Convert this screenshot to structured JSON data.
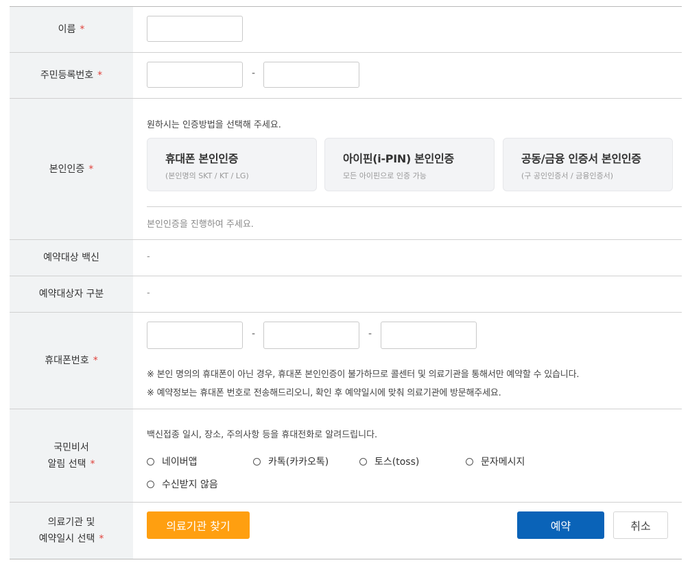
{
  "rows": {
    "name": {
      "label": "이름",
      "required": "*"
    },
    "rrn": {
      "label": "주민등록번호",
      "required": "*",
      "separator": "-"
    },
    "auth": {
      "label": "본인인증",
      "required": "*",
      "intro": "원하시는 인증방법을 선택해 주세요.",
      "methods": [
        {
          "title": "휴대폰 본인인증",
          "sub": "(본인명의 SKT / KT / LG)"
        },
        {
          "title": "아이핀(i-PIN) 본인인증",
          "sub": "모든 아이핀으로 인증 가능"
        },
        {
          "title": "공동/금융 인증서 본인인증",
          "sub": "(구 공인인증서 / 금융인증서)"
        }
      ],
      "status": "본인인증을 진행하여 주세요."
    },
    "vaccine": {
      "label": "예약대상 백신",
      "value": "-"
    },
    "category": {
      "label": "예약대상자 구분",
      "value": "-"
    },
    "phone": {
      "label": "휴대폰번호",
      "required": "*",
      "separator": "-",
      "notes": [
        "※ 본인 명의의 휴대폰이 아닌 경우, 휴대폰 본인인증이 불가하므로 콜센터 및 의료기관을 통해서만 예약할 수 있습니다.",
        "※ 예약정보는 휴대폰 번호로 전송해드리오니, 확인 후 예약일시에 맞춰 의료기관에 방문해주세요."
      ]
    },
    "notify": {
      "label_line1": "국민비서",
      "label_line2": "알림 선택",
      "required": "*",
      "intro": "백신접종 일시, 장소, 주의사항 등을 휴대전화로 알려드립니다.",
      "options": [
        "네이버앱",
        "카톡(카카오톡)",
        "토스(toss)",
        "문자메시지",
        "수신받지 않음"
      ]
    },
    "clinic": {
      "label_line1": "의료기관 및",
      "label_line2": "예약일시 선택",
      "required": "*",
      "find_button": "의료기관 찾기",
      "reserve_button": "예약",
      "cancel_button": "취소"
    }
  },
  "colors": {
    "label_bg": "#f1f3f4",
    "required": "#e0413a",
    "orange": "#ff9f10",
    "blue": "#0a63b8"
  }
}
